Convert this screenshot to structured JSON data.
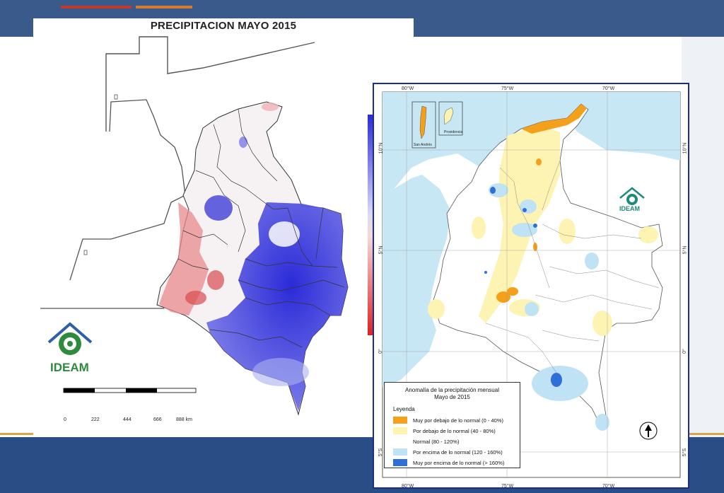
{
  "left_map": {
    "title": "PRECIPITACION MAYO 2015",
    "logo_text": "IDEAM",
    "scale_labels": [
      "0",
      "222",
      "444",
      "666",
      "888 km"
    ]
  },
  "right_map": {
    "coords_top": [
      "80°W",
      "75°W",
      "70°W"
    ],
    "coords_bottom": [
      "80°W",
      "75°W",
      "70°W"
    ],
    "coords_left": [
      "10°N",
      "5°N",
      "0°",
      "5°S"
    ],
    "coords_right": [
      "10°N",
      "5°N",
      "0°",
      "5°S"
    ],
    "islands": [
      "San Andrés",
      "Providencia"
    ],
    "logo_text": "IDEAM",
    "legend": {
      "title_line1": "Anomalía de la precipitación mensual",
      "title_line2": "Mayo de 2015",
      "heading": "Leyenda",
      "items": [
        {
          "label": "Muy por debajo de lo normal (0 - 40%)",
          "color": "#f5a01a"
        },
        {
          "label": "Por debajo de lo normal (40 - 80%)",
          "color": "#fdf3b3"
        },
        {
          "label": "Normal (80 - 120%)",
          "color": "#ffffff"
        },
        {
          "label": "Por encima de lo normal (120 - 160%)",
          "color": "#bfe3f5"
        },
        {
          "label": "Muy por encima de lo normal (> 160%)",
          "color": "#2f6fd8"
        }
      ]
    }
  },
  "colors": {
    "frame_blue": "#1b2c9a",
    "sea": "#c7e7f4",
    "ideam_green": "#2e8a3c"
  }
}
